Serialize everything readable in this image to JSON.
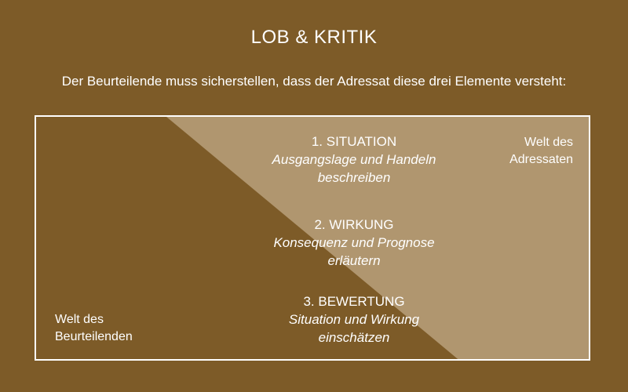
{
  "title": "LOB & KRITIK",
  "subtitle": "Der Beurteilende muss sicherstellen, dass der Adressat diese drei Elemente versteht:",
  "colors": {
    "background": "#7d5b28",
    "adressat_area": "#b0966f",
    "text": "#ffffff"
  },
  "elements": [
    {
      "heading": "1. SITUATION",
      "line1": "Ausgangslage und Handeln",
      "line2": "beschreiben"
    },
    {
      "heading": "2. WIRKUNG",
      "line1": "Konsequenz und Prognose",
      "line2": "erläutern"
    },
    {
      "heading": "3. BEWERTUNG",
      "line1": "Situation und Wirkung",
      "line2": "einschätzen"
    }
  ],
  "world_adressat": {
    "line1": "Welt des",
    "line2": "Adressaten"
  },
  "world_beurteilender": {
    "line1": "Welt des",
    "line2": "Beurteilenden"
  }
}
